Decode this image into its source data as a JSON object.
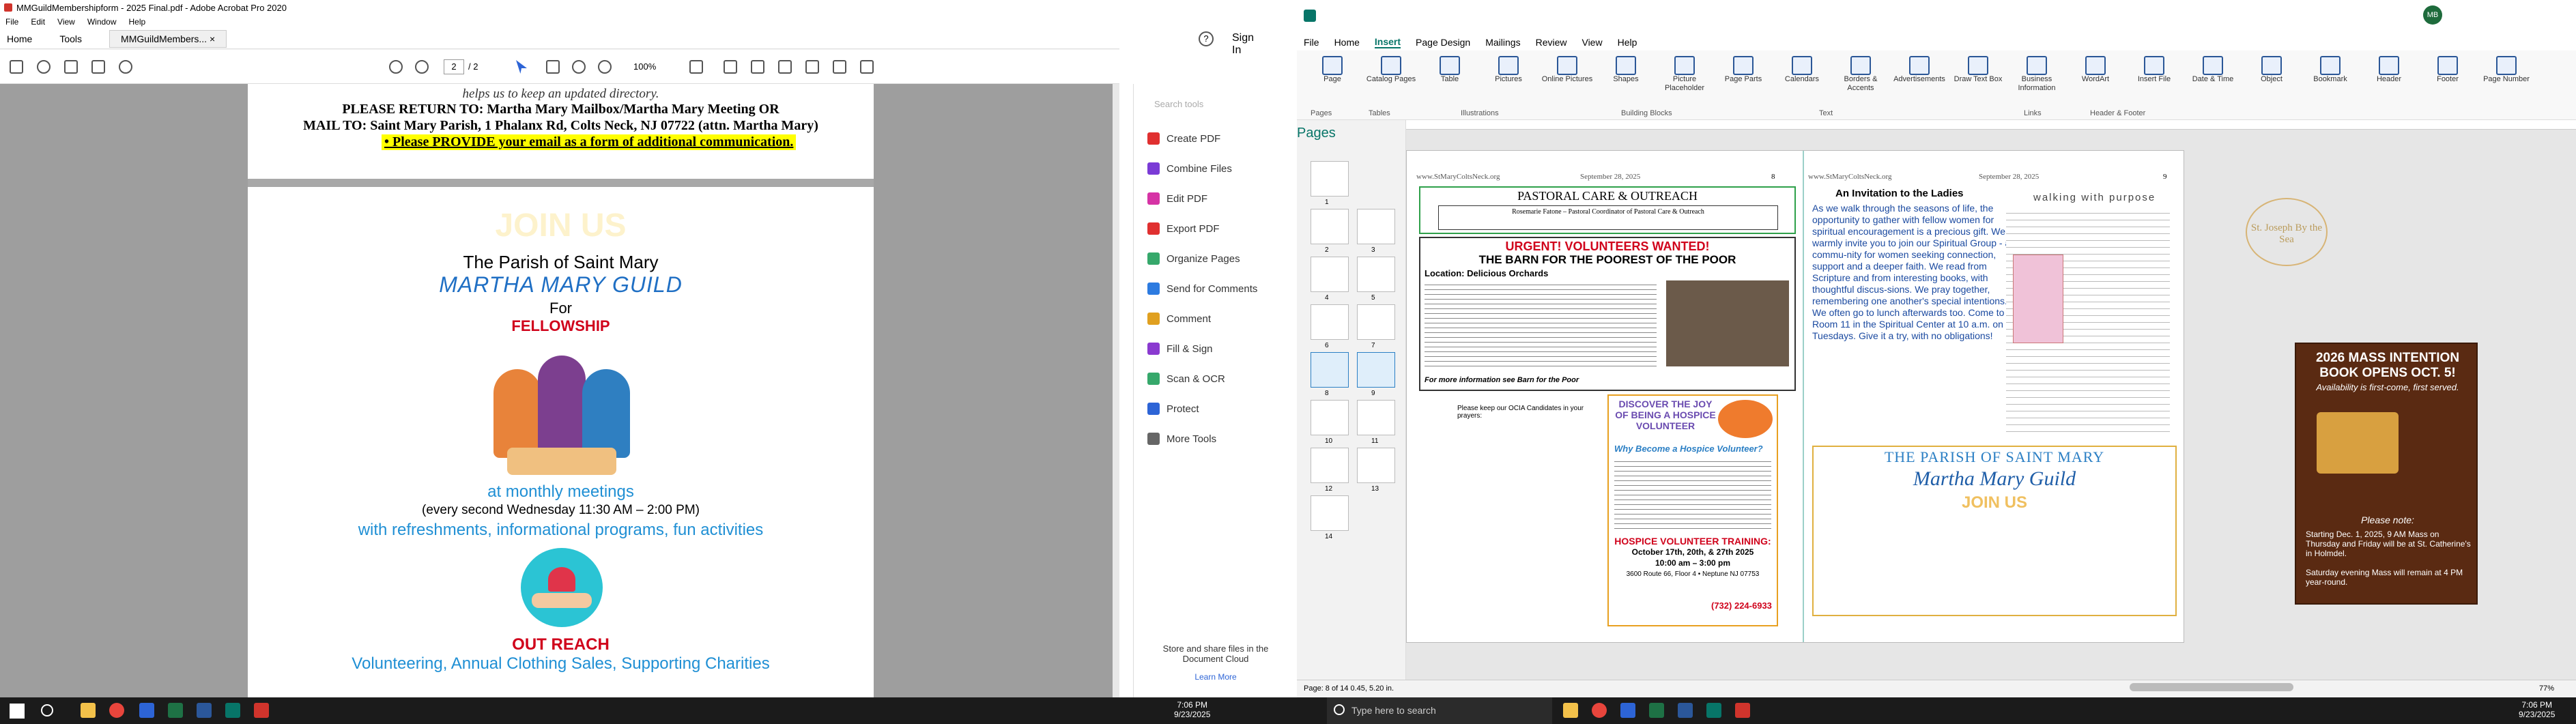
{
  "acrobat": {
    "title": "MMGuildMembershipform - 2025 Final.pdf - Adobe Acrobat Pro 2020",
    "menu": [
      "File",
      "Edit",
      "View",
      "Window",
      "Help"
    ],
    "tabs": [
      "Home",
      "Tools",
      "MMGuildMembers..."
    ],
    "page_current": "2",
    "page_total": "/ 2",
    "zoom": "100%",
    "sign_in": "Sign In",
    "doc": {
      "line0": "helps us to keep an updated directory.",
      "line1": "PLEASE RETURN TO: Martha Mary Mailbox/Martha Mary Meeting OR",
      "line2": "MAIL TO: Saint Mary Parish, 1 Phalanx Rd, Colts Neck, NJ 07722 (attn. Martha Mary)",
      "line3": "Please PROVIDE your email as a form of additional communication.",
      "join": "JOIN US",
      "parish": "The Parish of Saint Mary",
      "guild": "MARTHA MARY GUILD",
      "for": "For",
      "fellowship": "FELLOWSHIP",
      "monthly": "at monthly meetings",
      "second": "(every second Wednesday 11:30 AM – 2:00 PM)",
      "refresh": "with refreshments, informational  programs, fun activities",
      "outreach": "OUT REACH",
      "volunteer": "Volunteering, Annual Clothing Sales, Supporting Charities"
    },
    "tools": {
      "search": "Search tools",
      "items": [
        "Create PDF",
        "Combine Files",
        "Edit PDF",
        "Export PDF",
        "Organize Pages",
        "Send for Comments",
        "Comment",
        "Fill & Sign",
        "Scan & OCR",
        "Protect",
        "More Tools"
      ],
      "colors": [
        "#e03030",
        "#7a3bd6",
        "#d633a5",
        "#e03030",
        "#36a86b",
        "#2d7be0",
        "#e0a020",
        "#8a3ad0",
        "#36a86b",
        "#2d64d6",
        "#666666"
      ],
      "cloud": "Store and share files in the Document Cloud",
      "learn": "Learn More"
    }
  },
  "publisher": {
    "tabs": [
      "File",
      "Home",
      "Insert",
      "Page Design",
      "Mailings",
      "Review",
      "View",
      "Help"
    ],
    "ribbon": [
      "Page",
      "Catalog Pages",
      "Table",
      "Pictures",
      "Online Pictures",
      "Shapes",
      "Picture Placeholder",
      "Page Parts",
      "Calendars",
      "Borders & Accents",
      "Advertisements",
      "Draw Text Box",
      "Business Information",
      "WordArt",
      "Insert File",
      "Date & Time",
      "Object",
      "Bookmark",
      "Header",
      "Footer",
      "Page Number"
    ],
    "groups": [
      "Pages",
      "Tables",
      "Illustrations",
      "Building Blocks",
      "Text",
      "Links",
      "Header & Footer"
    ],
    "pages_label": "Pages",
    "thumbs": [
      "1",
      "2",
      "3",
      "4",
      "5",
      "6",
      "7",
      "8",
      "9",
      "10",
      "11",
      "12",
      "13",
      "14"
    ],
    "status": "Page: 8 of 14   0.45, 5.20 in.",
    "zoom": "77%",
    "left_page": {
      "head": "www.StMaryColtsNeck.org",
      "date": "September 28, 2025",
      "num": "8",
      "pastoral": "PASTORAL CARE & OUTREACH",
      "rosemarie": "Rosemarie Fatone – Pastoral Coordinator of Pastoral Care & Outreach",
      "urgent": "URGENT! VOLUNTEERS WANTED!",
      "barn": "THE BARN FOR THE POOREST OF THE POOR",
      "location": "Location: Delicious Orchards",
      "more": "For more information see Barn for the Poor",
      "keep": "Please keep our OCIA Candidates in your prayers:",
      "discover": "DISCOVER THE JOY OF BEING A HOSPICE VOLUNTEER",
      "why": "Why Become a Hospice Volunteer?",
      "training": "HOSPICE VOLUNTEER TRAINING:",
      "dates": "October 17th, 20th, & 27th 2025",
      "time": "10:00 am – 3:00 pm",
      "address": "3600 Route 66, Floor 4 • Neptune NJ 07753",
      "phone": "(732) 224-6933"
    },
    "right_page": {
      "head": "www.StMaryColtsNeck.org",
      "date": "September 28, 2025",
      "num": "9",
      "invite": "An Invitation to the Ladies",
      "body": "As we walk through the seasons of life, the opportunity to gather with fellow women for spiritual encouragement is a precious gift.  We warmly invite you to join our Spiritual Group - a commu-nity for women seeking connection, support and a deeper faith.  We read from Scripture and from interesting books, with thoughtful discus-sions.  We pray together, remembering one another's special intentions. We often go to lunch afterwards too.  Come to Room 11 in the Spiritual Center at 10 a.m. on Tuesdays.  Give it a try, with no obligations!",
      "walking": "walking with purpose",
      "parish": "THE PARISH OF SAINT MARY",
      "guild": "Martha Mary Guild",
      "join": "JOIN US"
    },
    "mass": {
      "title": "2026 MASS INTENTION BOOK OPENS OCT. 5!",
      "avail": "Availability is first-come, first served.",
      "note": "Please note:",
      "items": [
        "Starting Dec. 1, 2025, 9 AM Mass on Thursday and Friday will be at St. Catherine's in Holmdel.",
        "Saturday evening Mass will remain at 4 PM year-round."
      ]
    },
    "sticker": "St. Joseph By the Sea"
  },
  "taskbar": {
    "search": "Type here to search",
    "time_left": "7:06 PM",
    "date_left": "9/23/2025",
    "time_right": "7:06 PM",
    "date_right": "9/23/2025"
  }
}
